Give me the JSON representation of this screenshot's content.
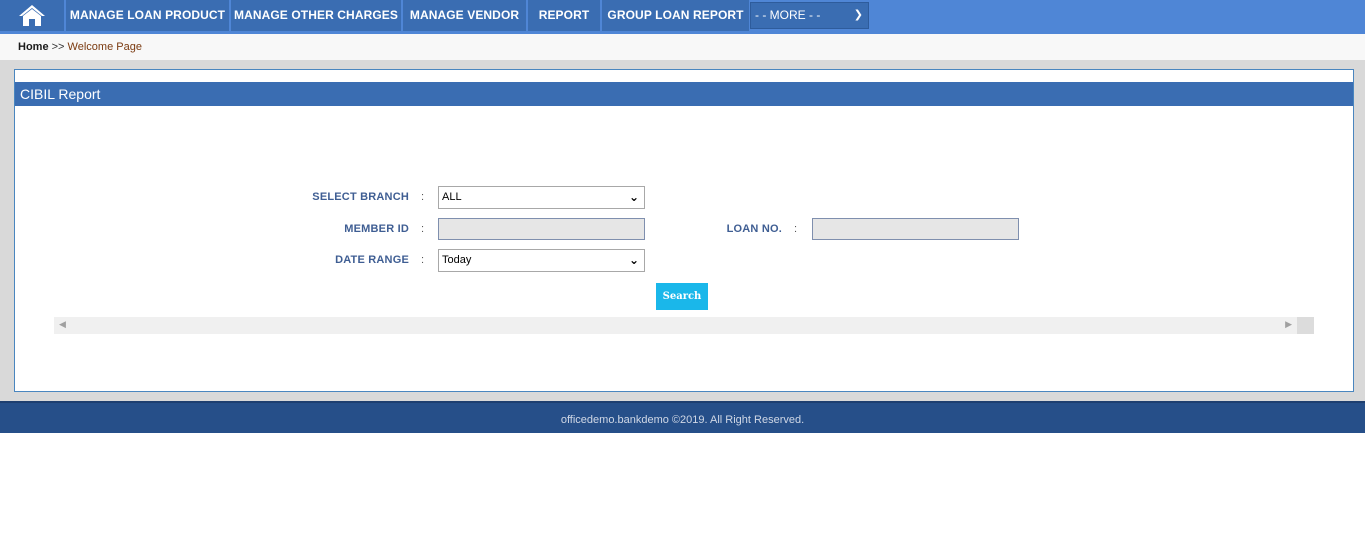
{
  "nav": {
    "home_icon": "home-icon",
    "items": [
      {
        "label": "MANAGE LOAN PRODUCT"
      },
      {
        "label": "MANAGE OTHER CHARGES"
      },
      {
        "label": "MANAGE VENDOR"
      },
      {
        "label": "REPORT"
      },
      {
        "label": "GROUP LOAN REPORT"
      }
    ],
    "more_label": "- - MORE - -"
  },
  "breadcrumb": {
    "home": "Home",
    "separator": ">>",
    "current": "Welcome Page"
  },
  "panel": {
    "title": "CIBIL Report"
  },
  "form": {
    "branch": {
      "label": "SELECT BRANCH",
      "colon": ":",
      "value": "ALL"
    },
    "member_id": {
      "label": "MEMBER ID",
      "colon": ":",
      "value": ""
    },
    "loan_no": {
      "label": "LOAN NO.",
      "colon": ":",
      "value": ""
    },
    "date_range": {
      "label": "DATE RANGE",
      "colon": ":",
      "value": "Today"
    },
    "search_label": "Search"
  },
  "footer": {
    "text": "officedemo.bankdemo ©2019. All Right Reserved."
  },
  "colors": {
    "nav_bar": "#4f86d6",
    "nav_item": "#3a6db2",
    "panel_header": "#3a6db2",
    "footer": "#264f89",
    "search_button": "#1ab7ea",
    "label_text": "#3f5e93"
  }
}
